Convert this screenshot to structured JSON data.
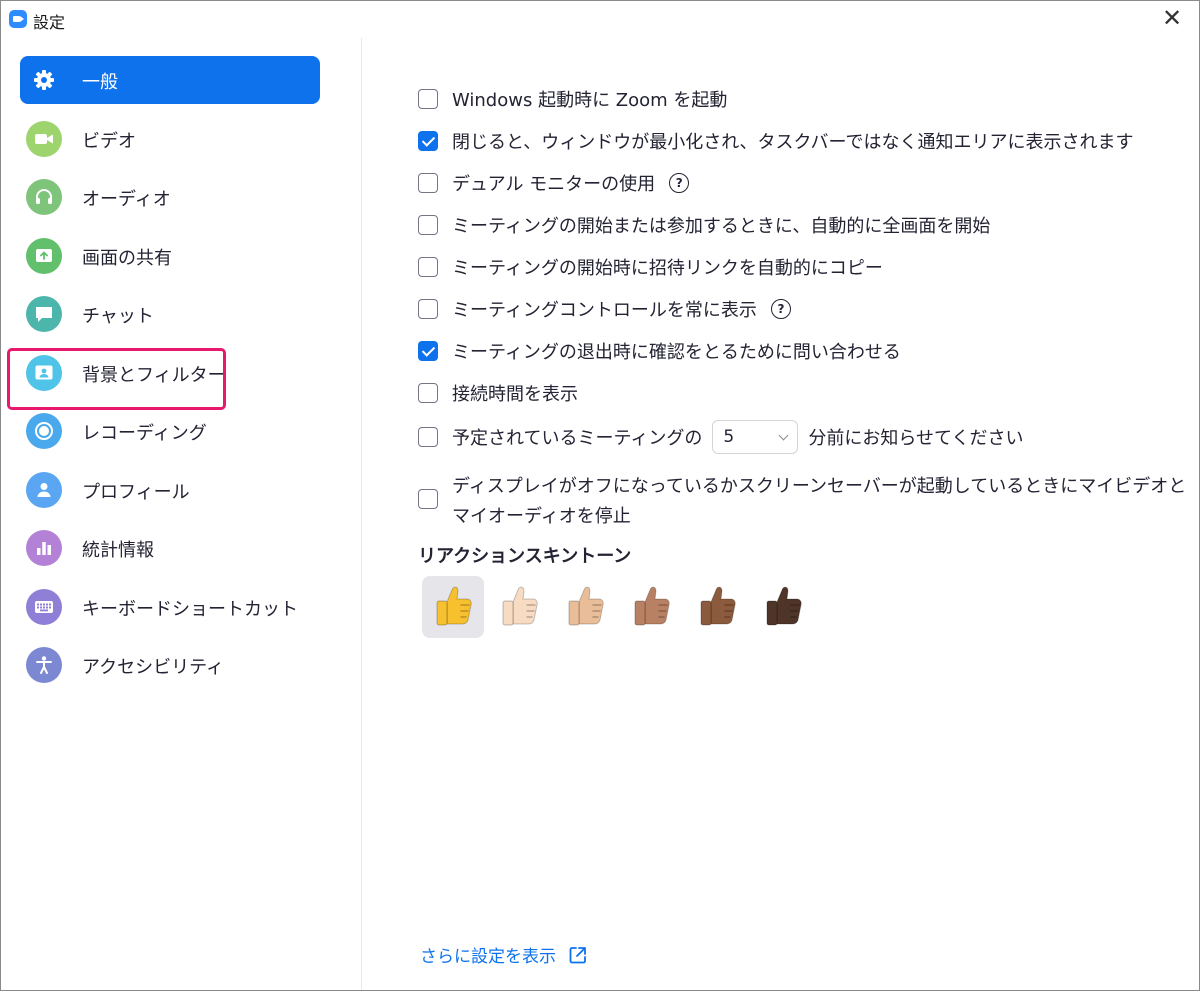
{
  "window": {
    "title": "設定"
  },
  "sidebar": {
    "items": [
      {
        "label": "一般",
        "icon": "gear-icon",
        "color": "#0e72ed",
        "active": true
      },
      {
        "label": "ビデオ",
        "icon": "video-camera-icon",
        "color": "#9ed46d"
      },
      {
        "label": "オーディオ",
        "icon": "headphones-icon",
        "color": "#7fc47b"
      },
      {
        "label": "画面の共有",
        "icon": "share-screen-icon",
        "color": "#62bf6c"
      },
      {
        "label": "チャット",
        "icon": "chat-bubble-icon",
        "color": "#4db6ac"
      },
      {
        "label": "背景とフィルター",
        "icon": "background-person-icon",
        "color": "#4fc3e8"
      },
      {
        "label": "レコーディング",
        "icon": "record-icon",
        "color": "#4aa9ec"
      },
      {
        "label": "プロフィール",
        "icon": "profile-icon",
        "color": "#5aa6f2"
      },
      {
        "label": "統計情報",
        "icon": "bar-chart-icon",
        "color": "#b381d6"
      },
      {
        "label": "キーボードショートカット",
        "icon": "keyboard-icon",
        "color": "#8f7fd6"
      },
      {
        "label": "アクセシビリティ",
        "icon": "accessibility-icon",
        "color": "#7d88d2"
      }
    ],
    "highlight_color": "#e8186f"
  },
  "general": {
    "options": [
      {
        "label": "Windows 起動時に Zoom を起動",
        "checked": false
      },
      {
        "label": "閉じると、ウィンドウが最小化され、タスクバーではなく通知エリアに表示されます",
        "checked": true
      },
      {
        "label": "デュアル モニターの使用",
        "checked": false,
        "help": true
      },
      {
        "label": "ミーティングの開始または参加するときに、自動的に全画面を開始",
        "checked": false
      },
      {
        "label": "ミーティングの開始時に招待リンクを自動的にコピー",
        "checked": false
      },
      {
        "label": "ミーティングコントロールを常に表示",
        "checked": false,
        "help": true
      },
      {
        "label": "ミーティングの退出時に確認をとるために問い合わせる",
        "checked": true
      },
      {
        "label": "接続時間を表示",
        "checked": false
      }
    ],
    "reminder": {
      "prefix": "予定されているミーティングの",
      "value": "5",
      "suffix": "分前にお知らせてください",
      "checked": false
    },
    "stop_av": {
      "label": "ディスプレイがオフになっているかスクリーンセーバーが起動しているときにマイビデオとマイオーディオを停止",
      "checked": false
    },
    "reaction": {
      "title": "リアクションスキントーン",
      "tones": [
        "#f6c02e",
        "#f7dcc3",
        "#e9bd98",
        "#b98163",
        "#8c5a3c",
        "#4e3528"
      ],
      "selected_index": 0
    },
    "help_glyph": "?",
    "more_link": "さらに設定を表示"
  },
  "accent_color": "#0e72ed"
}
